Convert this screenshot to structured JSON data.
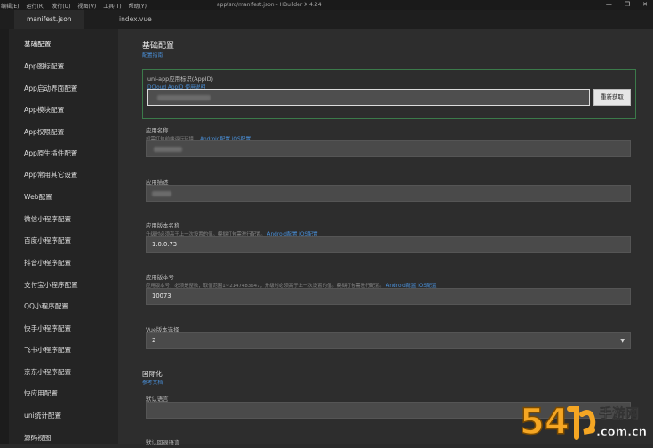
{
  "titlebar": {
    "menu": [
      "编辑(E)",
      "运行(R)",
      "发行(U)",
      "视图(V)",
      "工具(T)",
      "帮助(Y)"
    ],
    "title": "app/src/manifest.json - HBuilder X 4.24",
    "controls": [
      "—",
      "❐",
      "✕"
    ]
  },
  "tabs": [
    "manifest.json",
    "index.vue"
  ],
  "sidebar": {
    "items": [
      "基础配置",
      "App图标配置",
      "App启动界面配置",
      "App模块配置",
      "App权限配置",
      "App原生插件配置",
      "App常用其它设置",
      "Web配置",
      "微信小程序配置",
      "百度小程序配置",
      "抖音小程序配置",
      "支付宝小程序配置",
      "QQ小程序配置",
      "快手小程序配置",
      "飞书小程序配置",
      "京东小程序配置",
      "快应用配置",
      "uni统计配置",
      "源码视图"
    ]
  },
  "main": {
    "title": "基础配置",
    "title_link": "配置指南",
    "appid": {
      "label": "uni-app应用标识(AppID)",
      "link": "DCloud AppID 使用说明",
      "value": "__UNI__...",
      "button": "重新获取"
    },
    "name": {
      "label": "应用名称",
      "hint": "如需打包前端运行环境，",
      "links": [
        "Android配置",
        "iOS配置"
      ]
    },
    "desc": {
      "label": "应用描述"
    },
    "version_name": {
      "label": "应用版本名称",
      "hint": "升级时必须高于上一次设置的值。模拟打包需进行配置。",
      "links": [
        "Android配置",
        "iOS配置"
      ],
      "value": "1.0.0.73"
    },
    "version_code": {
      "label": "应用版本号",
      "hint": "应用版本号，必须是整数；取值范围1~2147483647；升级时必须高于上一次设置的值。模拟打包需进行配置。",
      "links": [
        "Android配置",
        "iOS配置"
      ],
      "value": "10073"
    },
    "vue_version": {
      "label": "Vue版本选择",
      "value": "2"
    },
    "i18n": {
      "title": "国际化",
      "link": "参考文档",
      "default_lang_label": "默认语言",
      "fallback_label": "默认回退语言"
    }
  },
  "watermark": {
    "big": "54",
    "site_cn": "手游网",
    "site_en": ".com.cn",
    "colors": {
      "orange": "#f5a623",
      "white": "#ffffff"
    }
  },
  "colors": {
    "accent_link": "#4a90d9",
    "focus_border": "#3b7a4a"
  }
}
